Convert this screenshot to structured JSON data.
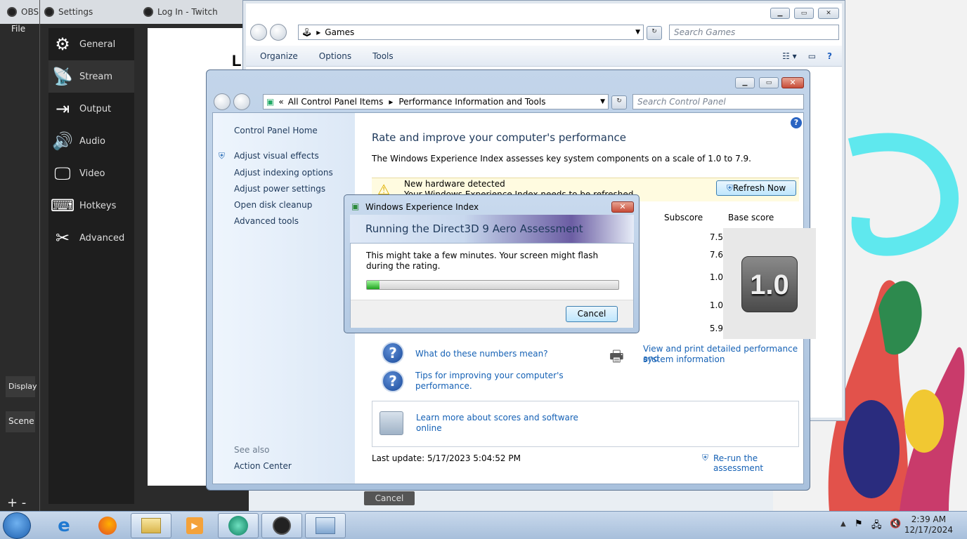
{
  "obs_main": {
    "title": "OBS",
    "menu_file": "File",
    "dock_display": "Display",
    "dock_scene": "Scene"
  },
  "settings": {
    "title": "Settings",
    "items": [
      {
        "label": "General",
        "icon": "gear-icon"
      },
      {
        "label": "Stream",
        "icon": "antenna-icon"
      },
      {
        "label": "Output",
        "icon": "output-icon"
      },
      {
        "label": "Audio",
        "icon": "speaker-icon"
      },
      {
        "label": "Video",
        "icon": "monitor-icon"
      },
      {
        "label": "Hotkeys",
        "icon": "keyboard-icon"
      },
      {
        "label": "Advanced",
        "icon": "tools-icon"
      }
    ]
  },
  "twitch": {
    "title": "Log In - Twitch",
    "heading_letter": "L",
    "cancel_label": "Cancel"
  },
  "games": {
    "address": "Games",
    "search_placeholder": "Search Games",
    "toolbar": {
      "organize": "Organize",
      "options": "Options",
      "tools": "Tools"
    }
  },
  "perf": {
    "breadcrumb_root": "All Control Panel Items",
    "breadcrumb_page": "Performance Information and Tools",
    "search_placeholder": "Search Control Panel",
    "left_links": {
      "home": "Control Panel Home",
      "visual": "Adjust visual effects",
      "indexing": "Adjust indexing options",
      "power": "Adjust power settings",
      "cleanup": "Open disk cleanup",
      "advanced": "Advanced tools",
      "see_also": "See also",
      "action_center": "Action Center"
    },
    "heading": "Rate and improve your computer's performance",
    "description": "The Windows Experience Index assesses key system components on a scale of 1.0 to 7.9.",
    "banner_title": "New hardware detected",
    "banner_subtitle": "Your Windows Experience Index needs to be refreshed",
    "refresh_label": "Refresh Now",
    "col_subscore": "Subscore",
    "col_base": "Base score",
    "subscores": [
      "7.5",
      "7.6",
      "1.0",
      "1.0",
      "5.9"
    ],
    "base_score": "1.0",
    "links": {
      "numbers": "What do these numbers mean?",
      "tips_line1": "Tips for improving your computer's",
      "tips_line2": "performance.",
      "print_line1": "View and print detailed performance and",
      "print_line2": "system information",
      "learn_line1": "Learn more about scores and software",
      "learn_line2": "online"
    },
    "last_update": "Last update: 5/17/2023 5:04:52 PM",
    "rerun": "Re-run the assessment"
  },
  "dialog": {
    "title": "Windows Experience Index",
    "header": "Running the Direct3D 9 Aero Assessment",
    "message_line1": "This might take a few minutes. Your screen might flash",
    "message_line2": "during the rating.",
    "progress": 0.05,
    "cancel_label": "Cancel"
  },
  "taskbar": {
    "time": "2:39 AM",
    "date": "12/17/2024"
  }
}
